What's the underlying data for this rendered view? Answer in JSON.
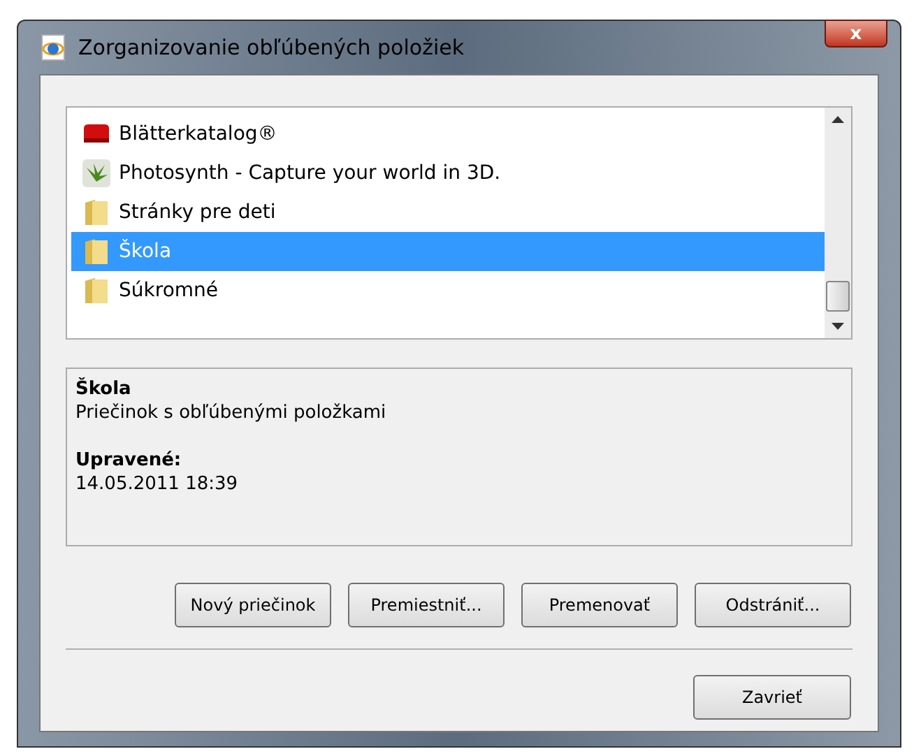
{
  "window": {
    "title": "Zorganizovanie obľúbených položiek",
    "close_glyph": "x"
  },
  "favorites": [
    {
      "label": "Blätterkatalog®",
      "kind": "red",
      "selected": false
    },
    {
      "label": "Photosynth - Capture your world in 3D.",
      "kind": "plant",
      "selected": false
    },
    {
      "label": "Stránky pre deti",
      "kind": "folder",
      "selected": false
    },
    {
      "label": "Škola",
      "kind": "folder",
      "selected": true
    },
    {
      "label": "Súkromné",
      "kind": "folder",
      "selected": false
    }
  ],
  "details": {
    "name": "Škola",
    "description": "Priečinok s obľúbenými položkami",
    "modified_label": "Upravené:",
    "modified": "14.05.2011 18:39"
  },
  "buttons": [
    {
      "label": "Nový priečinok"
    },
    {
      "label": "Premiestniť..."
    },
    {
      "label": "Premenovať"
    },
    {
      "label": "Odstrániť..."
    }
  ],
  "close_button": {
    "label": "Zavrieť"
  }
}
